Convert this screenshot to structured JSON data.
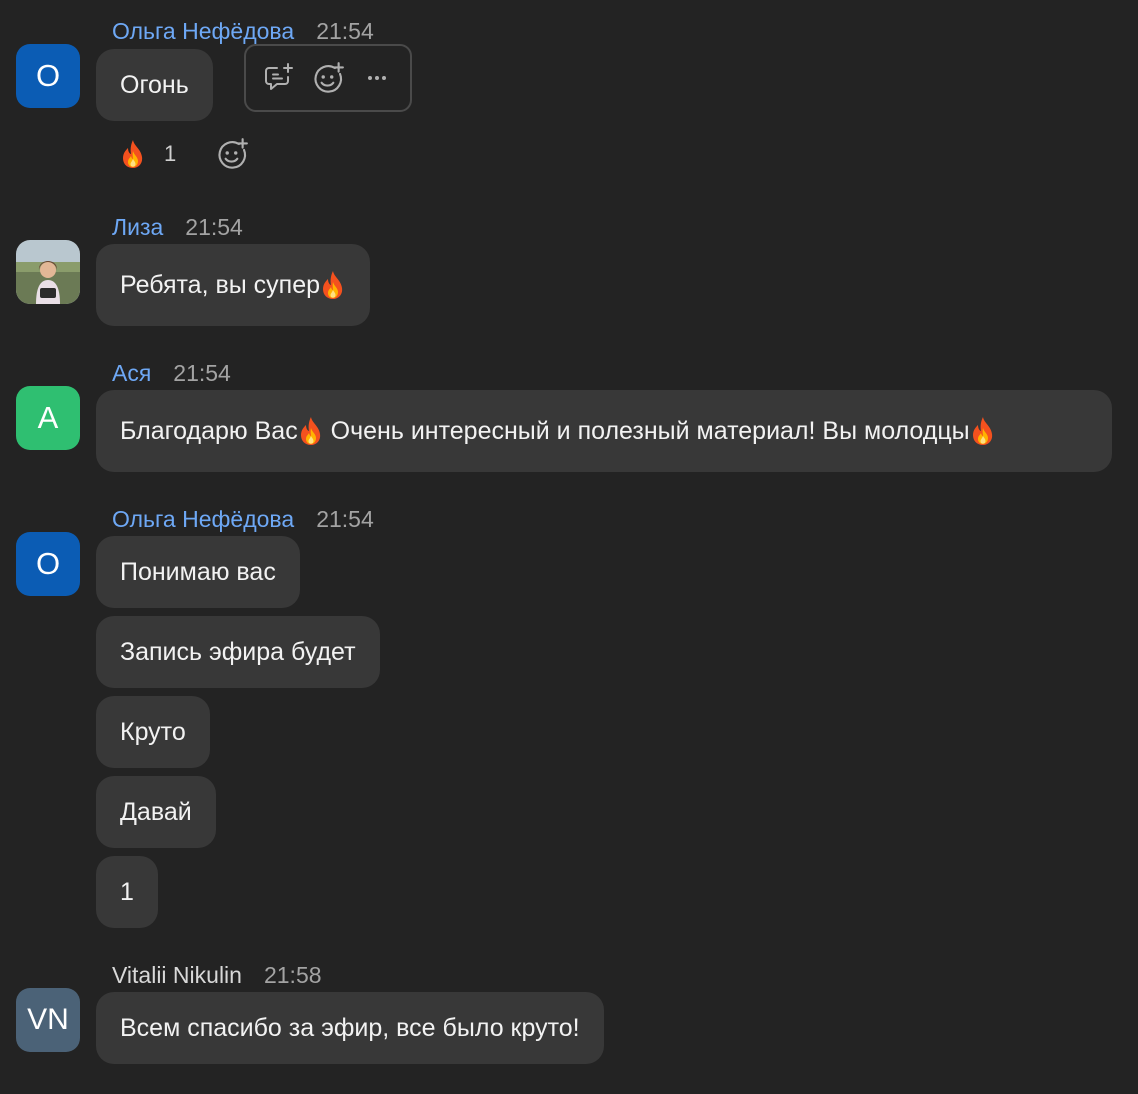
{
  "colors": {
    "background": "#232323",
    "bubble": "#383838",
    "name_link": "#6ea8f5",
    "avatar_blue": "#0b5cb4",
    "avatar_green": "#2fbf71",
    "avatar_slate": "#4b6277"
  },
  "messages": [
    {
      "author": "Ольга Нефёдова",
      "time": "21:54",
      "avatar_initial": "О",
      "bubbles": [
        "Огонь"
      ],
      "reaction": {
        "emoji_icon": "fire-icon",
        "count": "1"
      }
    },
    {
      "author": "Лиза",
      "time": "21:54",
      "avatar_icon": "user-photo",
      "bubbles": [
        "Ребята, вы супер"
      ]
    },
    {
      "author": "Ася",
      "time": "21:54",
      "avatar_initial": "А",
      "bubbles": [
        "Благодарю Вас",
        " Очень интересный и полезный материал! Вы молодцы"
      ]
    },
    {
      "author": "Ольга Нефёдова",
      "time": "21:54",
      "avatar_initial": "О",
      "bubbles": [
        "Понимаю вас",
        "Запись эфира будет",
        "Круто",
        "Давай",
        "1"
      ]
    },
    {
      "author": "Vitalii Nikulin",
      "time": "21:58",
      "avatar_initial": "VN",
      "bubbles": [
        "Всем спасибо за эфир, все было круто!"
      ]
    }
  ],
  "toolbar_icons": [
    "reply-in-thread-icon",
    "add-reaction-icon",
    "more-options-icon"
  ]
}
